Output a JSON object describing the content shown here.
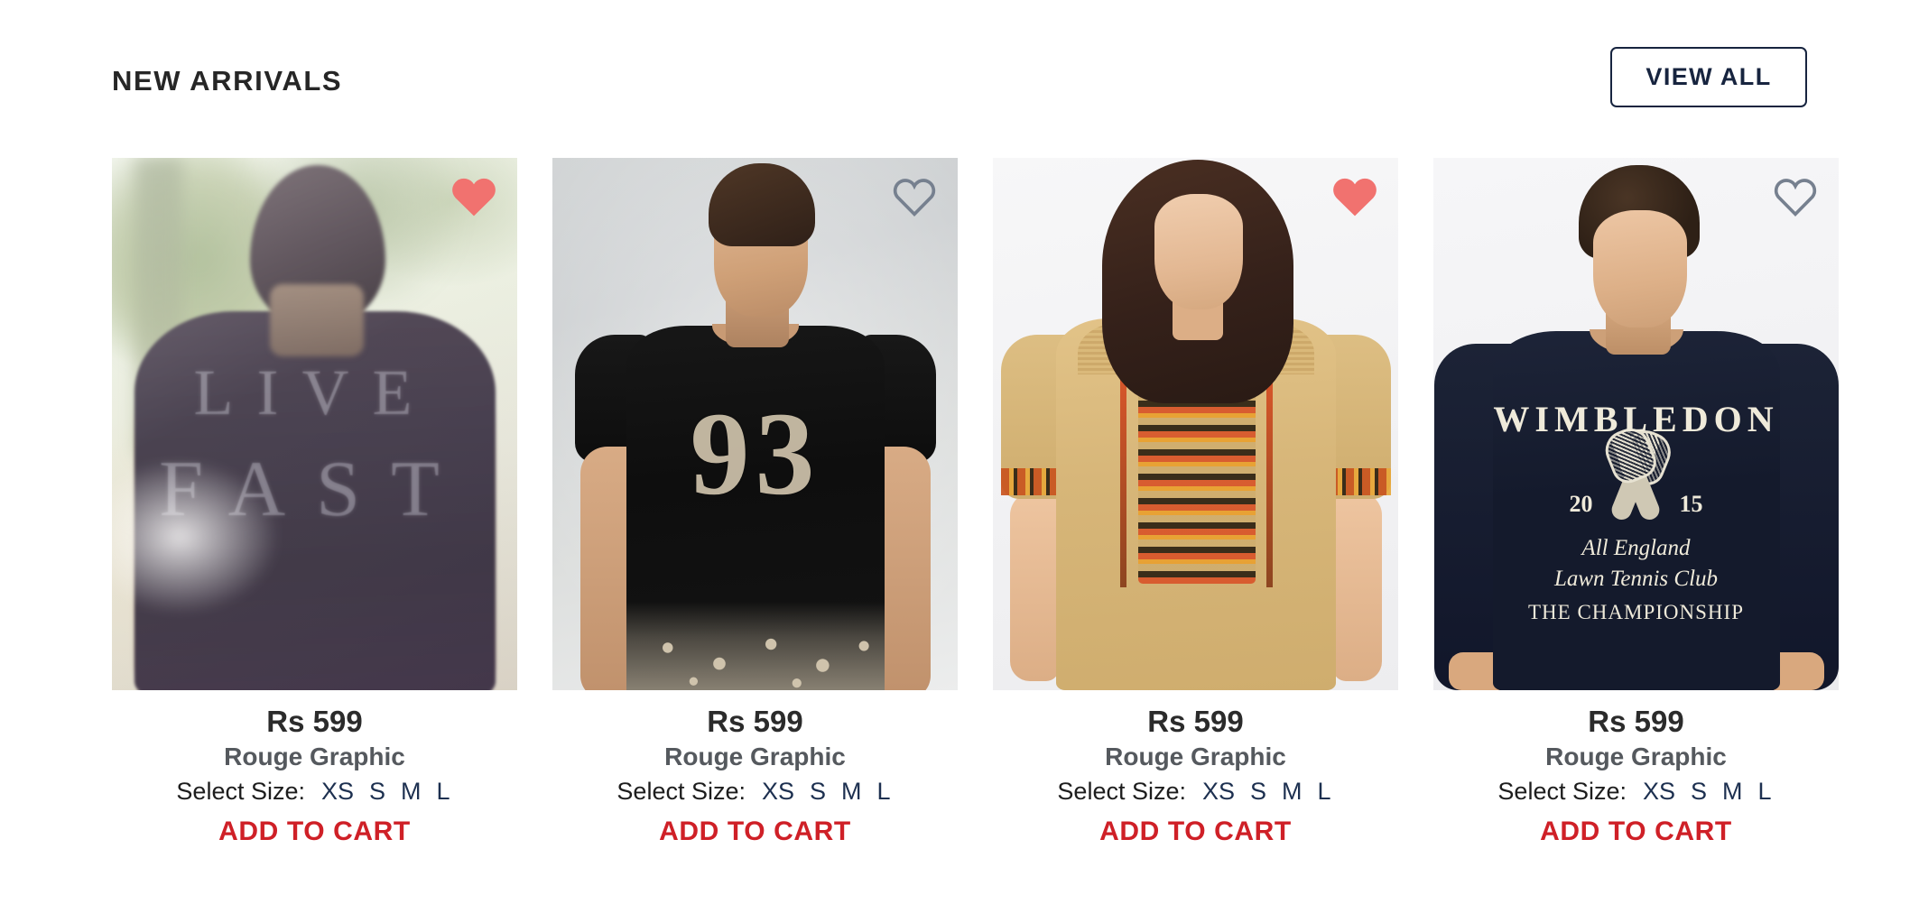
{
  "header": {
    "title": "NEW ARRIVALS",
    "view_all_label": "VIEW ALL"
  },
  "colors": {
    "accent_red": "#cf2027",
    "navy": "#17243f",
    "heart_filled": "#f1726f",
    "heart_outline": "#76808f",
    "title": "#262626",
    "product_name": "#55595e",
    "price": "#2b2b2b",
    "background": "#ffffff"
  },
  "size_label": "Select Size:",
  "products": [
    {
      "price": "Rs 599",
      "name": "Rouge Graphic",
      "size_label": "Select Size:",
      "sizes": [
        "XS",
        "S",
        "M",
        "L"
      ],
      "add_to_cart_label": "ADD TO CART",
      "wishlisted": true,
      "wishlist_icon": "heart-filled-icon",
      "image_alt": "man-back-live-fast-graphic-tee-outdoor",
      "graphic_line_1": "LIVE",
      "graphic_line_2": "FAST"
    },
    {
      "price": "Rs 599",
      "name": "Rouge Graphic",
      "size_label": "Select Size:",
      "sizes": [
        "XS",
        "S",
        "M",
        "L"
      ],
      "add_to_cart_label": "ADD TO CART",
      "wishlisted": false,
      "wishlist_icon": "heart-outline-icon",
      "image_alt": "man-black-93-paisley-print-tshirt",
      "graphic_number": "93"
    },
    {
      "price": "Rs 599",
      "name": "Rouge Graphic",
      "size_label": "Select Size:",
      "sizes": [
        "XS",
        "S",
        "M",
        "L"
      ],
      "add_to_cart_label": "ADD TO CART",
      "wishlisted": true,
      "wishlist_icon": "heart-filled-icon",
      "image_alt": "woman-tan-embroidered-tunic-top"
    },
    {
      "price": "Rs 599",
      "name": "Rouge Graphic",
      "size_label": "Select Size:",
      "sizes": [
        "XS",
        "S",
        "M",
        "L"
      ],
      "add_to_cart_label": "ADD TO CART",
      "wishlisted": false,
      "wishlist_icon": "heart-outline-icon",
      "image_alt": "man-navy-wimbledon-sweatshirt",
      "graphic_title": "WIMBLEDON",
      "graphic_year_left": "20",
      "graphic_year_right": "15",
      "graphic_line_3": "All England",
      "graphic_line_4": "Lawn Tennis Club",
      "graphic_line_5": "THE CHAMPIONSHIP"
    }
  ]
}
